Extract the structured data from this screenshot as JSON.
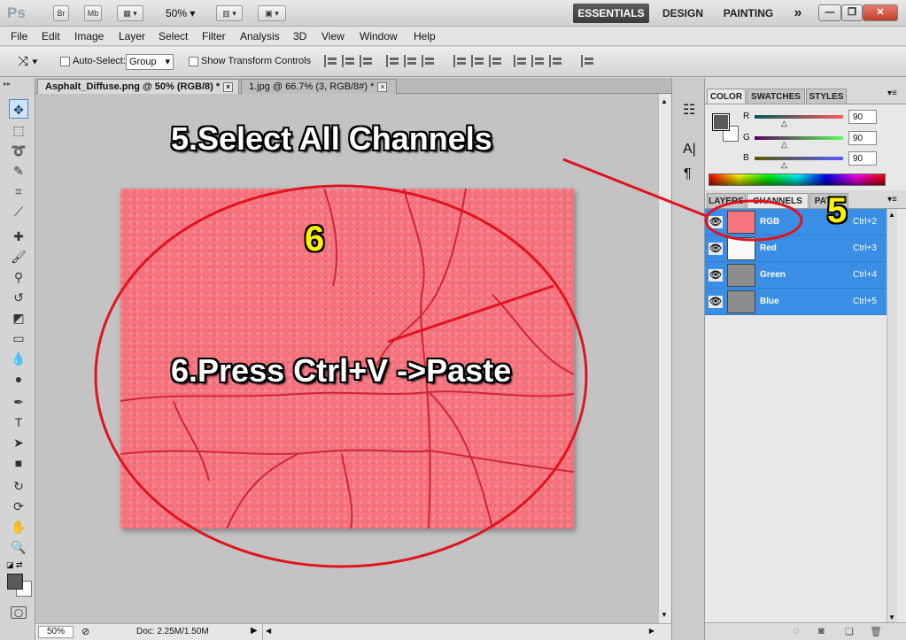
{
  "app": {
    "logo": "Ps",
    "bridge_label": "Br",
    "minibridge_label": "Mb",
    "zoom": "50%",
    "workspaces": [
      "ESSENTIALS",
      "DESIGN",
      "PAINTING"
    ],
    "more": "»"
  },
  "menu": [
    "File",
    "Edit",
    "Image",
    "Layer",
    "Select",
    "Filter",
    "Analysis",
    "3D",
    "View",
    "Window",
    "Help"
  ],
  "options": {
    "auto_select_label": "Auto-Select:",
    "auto_select_value": "Group",
    "transform_label": "Show Transform Controls"
  },
  "tabs": [
    {
      "label": "Asphalt_Diffuse.png @ 50% (RGB/8) *",
      "close": "×"
    },
    {
      "label": "1.jpg @ 66.7% (3, RGB/8#) *",
      "close": "×"
    }
  ],
  "status": {
    "zoom": "50%",
    "doc": "Doc: 2.25M/1.50M"
  },
  "color_panel": {
    "tabs": [
      "COLOR",
      "SWATCHES",
      "STYLES"
    ],
    "r_label": "R",
    "g_label": "G",
    "b_label": "B",
    "r": "90",
    "g": "90",
    "b": "90"
  },
  "layers_panel": {
    "tabs": [
      "LAYERS",
      "CHANNELS",
      "PATHS"
    ],
    "channels": [
      {
        "name": "RGB",
        "shortcut": "Ctrl+2"
      },
      {
        "name": "Red",
        "shortcut": "Ctrl+3"
      },
      {
        "name": "Green",
        "shortcut": "Ctrl+4"
      },
      {
        "name": "Blue",
        "shortcut": "Ctrl+5"
      }
    ]
  },
  "annotations": {
    "step5": "5.Select All Channels",
    "step6": "6.Press Ctrl+V ->Paste",
    "num5": "5",
    "num6": "6"
  },
  "colors": {
    "accent_selection": "#3a8ee6",
    "annotation_red": "#e0141e",
    "texture": "#f5747e"
  }
}
